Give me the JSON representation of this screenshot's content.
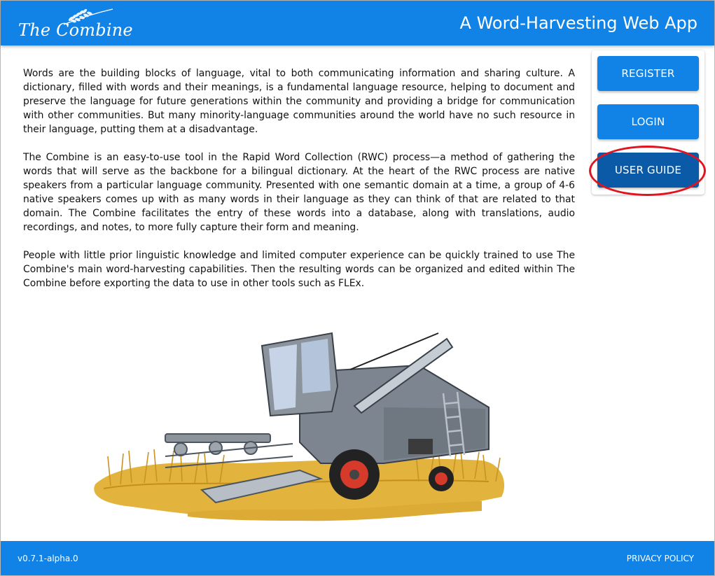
{
  "header": {
    "logo_text": "The Combine",
    "title": "A Word-Harvesting Web App"
  },
  "intro": {
    "paragraphs": [
      "Words are the building blocks of language, vital to both communicating information and sharing culture. A dictionary, filled with words and their meanings, is a fundamental language resource, helping to document and preserve the language for future generations within the community and providing a bridge for communication with other communities. But many minority-language communities around the world have no such resource in their language, putting them at a disadvantage.",
      "The Combine is an easy-to-use tool in the Rapid Word Collection (RWC) process—a method of gathering the words that will serve as the backbone for a bilingual dictionary. At the heart of the RWC process are native speakers from a particular language community. Presented with one semantic domain at a time, a group of 4-6 native speakers comes up with as many words in their language as they can think of that are related to that domain. The Combine facilitates the entry of these words into a database, along with translations, audio recordings, and notes, to more fully capture their form and meaning.",
      "People with little prior linguistic knowledge and limited computer experience can be quickly trained to use The Combine's main word-harvesting capabilities. Then the resulting words can be organized and edited within The Combine before exporting the data to use in other tools such as FLEx."
    ]
  },
  "side_buttons": {
    "register": "REGISTER",
    "login": "LOGIN",
    "user_guide": "USER GUIDE"
  },
  "footer": {
    "version": "v0.7.1-alpha.0",
    "privacy": "PRIVACY POLICY"
  },
  "colors": {
    "primary": "#1283e6",
    "user_guide_button": "#0a5aa8",
    "highlight_ring": "#e0141e"
  },
  "icons": {
    "logo": "wheat-icon",
    "illustration": "combine-harvester-illustration"
  }
}
